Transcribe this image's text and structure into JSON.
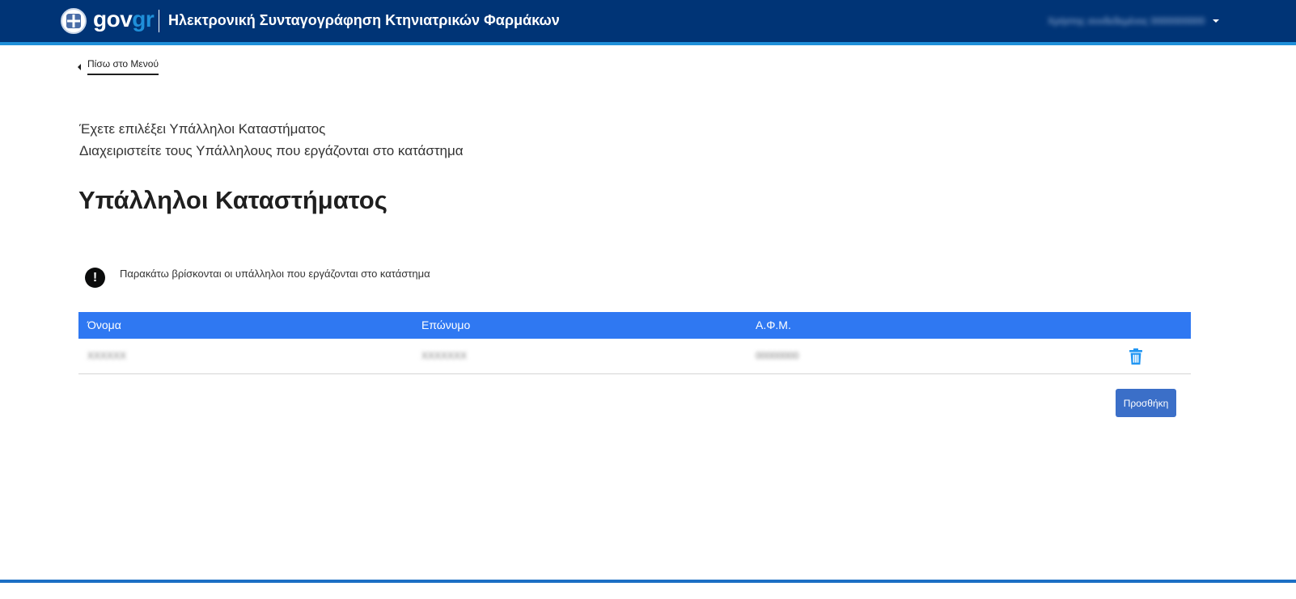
{
  "colors": {
    "header_bg": "#003476",
    "header_accent": "#1f8fd9",
    "table_header_bg": "#2f78f2",
    "button_bg": "#3b6fc8",
    "trash_icon": "#2196f3"
  },
  "header": {
    "logo_gov": "gov",
    "logo_gr": "gr",
    "emblem_icon": "greek-coat-of-arms-icon",
    "app_title": "Ηλεκτρονική Συνταγογράφηση Κτηνιατρικών Φαρμάκων",
    "user_name": "Χρήστης συνδεδεμένος 0000000000",
    "user_menu_icon": "caret-down-icon"
  },
  "nav": {
    "back_label": "Πίσω στο Μενού",
    "back_icon": "caret-left-icon"
  },
  "intro": {
    "line1": "Έχετε επιλέξει Υπάλληλοι Καταστήματος",
    "line2": "Διαχειριστείτε τους Υπάλληλους που εργάζονται στο κατάστημα"
  },
  "page_title": "Υπάλληλοι Καταστήματος",
  "notice": {
    "icon": "exclamation-circle-icon",
    "icon_glyph": "!",
    "text": "Παρακάτω βρίσκονται οι υπάλληλοι που εργάζονται στο κατάστημα"
  },
  "table": {
    "columns": [
      "Όνομα",
      "Επώνυμο",
      "Α.Φ.Μ."
    ],
    "rows": [
      {
        "first_name": "ΧΧΧΧΧΧ",
        "last_name": "ΧΧΧΧΧΧΧ",
        "afm": "00000000",
        "action_icon": "trash-icon"
      }
    ]
  },
  "actions": {
    "add_label": "Προσθήκη"
  }
}
